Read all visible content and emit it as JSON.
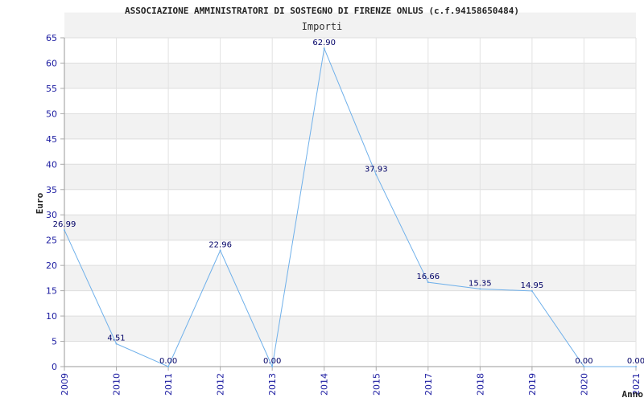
{
  "chart_data": {
    "type": "line",
    "title": "ASSOCIAZIONE AMMINISTRATORI DI SOSTEGNO DI FIRENZE ONLUS (c.f.94158650484)",
    "subtitle": "Importi",
    "xlabel": "Anno",
    "ylabel": "Euro",
    "ylim": [
      0,
      65
    ],
    "ytick_step": 5,
    "grid": true,
    "colors": {
      "line": "#6fb0ea",
      "band": "#f2f2f2",
      "tick_text": "#1a1aa0",
      "data_label": "#000066"
    },
    "categories": [
      "2009",
      "2010",
      "2011",
      "2012",
      "2013",
      "2014",
      "2015",
      "2017",
      "2018",
      "2019",
      "2020",
      "2021"
    ],
    "series": [
      {
        "values": [
          26.99,
          4.51,
          0.0,
          22.96,
          0.0,
          62.9,
          37.93,
          16.66,
          15.35,
          14.95,
          0.0,
          0.0
        ],
        "labels": [
          "26.99",
          "4.51",
          "0.00",
          "22.96",
          "0.00",
          "62.90",
          "37.93",
          "16.66",
          "15.35",
          "14.95",
          "0.00",
          "0.00"
        ]
      }
    ]
  }
}
